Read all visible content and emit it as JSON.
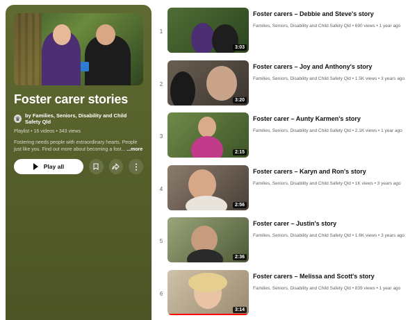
{
  "playlist": {
    "title": "Foster carer stories",
    "owner": "by Families, Seniors, Disability and Child Safety Qld",
    "meta": "Playlist • 16 videos • 343 views",
    "description": "Fostering needs people with extraordinary hearts. People just like you. Find out more about becoming a fost...",
    "more_label": "...more",
    "play_all_label": "Play all",
    "icons": [
      "save-icon",
      "share-icon",
      "more-icon"
    ]
  },
  "videos": [
    {
      "index": "1",
      "title": "Foster carers – Debbie and Steve's story",
      "meta": "Families, Seniors, Disability and Child Safety Qld • 690 views • 1 year ago",
      "duration": "3:03"
    },
    {
      "index": "2",
      "title": "Foster carers – Joy and Anthony's story",
      "meta": "Families, Seniors, Disability and Child Safety Qld • 1.5K views • 3 years ago",
      "duration": "3:20"
    },
    {
      "index": "3",
      "title": "Foster carer – Aunty Karmen's story",
      "meta": "Families, Seniors, Disability and Child Safety Qld • 2.1K views • 1 year ago",
      "duration": "2:15"
    },
    {
      "index": "4",
      "title": "Foster carers – Karyn and Ron's story",
      "meta": "Families, Seniors, Disability and Child Safety Qld • 1K views • 3 years ago",
      "duration": "2:56"
    },
    {
      "index": "5",
      "title": "Foster carer – Justin's story",
      "meta": "Families, Seniors, Disability and Child Safety Qld • 1.6K views • 3 years ago",
      "duration": "2:36"
    },
    {
      "index": "6",
      "title": "Foster carers – Melissa and Scott's story",
      "meta": "Families, Seniors, Disability and Child Safety Qld • 839 views • 1 year ago",
      "duration": "3:14",
      "watched_fraction": 1.0
    }
  ],
  "colors": {
    "panel_bg": "#56602c",
    "progress": "#ff0000"
  }
}
